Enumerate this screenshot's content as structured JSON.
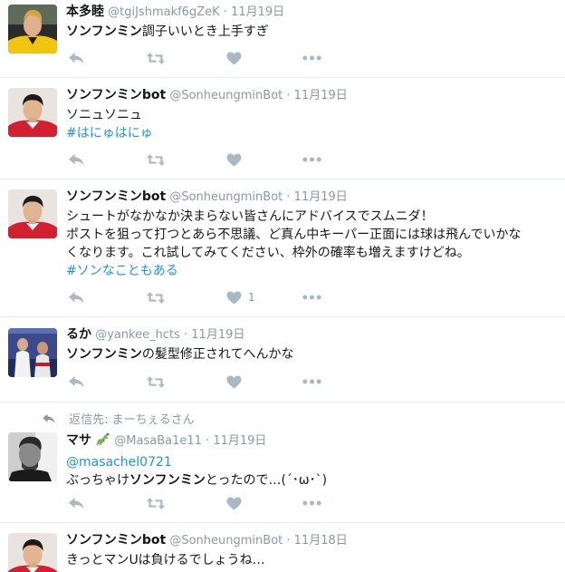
{
  "tweets": [
    {
      "name": "本多睦",
      "handle": "@tgiJshmakf6gZeK",
      "time": "11月19日",
      "body_hl": "ソンフンミン",
      "body_rest": "調子いいとき上手すぎ"
    },
    {
      "name": "ソンフンミンbot",
      "handle": "@SonheungminBot",
      "time": "11月19日",
      "line1": "ソニュソニュ",
      "hashtag": "#はにゅはにゅ"
    },
    {
      "name": "ソンフンミンbot",
      "handle": "@SonheungminBot",
      "time": "11月19日",
      "line1": "シュートがなかなか決まらない皆さんにアドバイスでスムニダ！",
      "line2": "ポストを狙って打つとあら不思議、ど真ん中キーパー正面には球は飛んでいかな",
      "line3": "くなります。これ試してみてください、枠外の確率も増えますけどね。",
      "hashtag": "#ソンなこともある",
      "like_count": "1"
    },
    {
      "name": "るか",
      "handle": "@yankee_hcts",
      "time": "11月19日",
      "body_hl": "ソンフンミン",
      "body_rest": "の髪型修正されてへんかな"
    },
    {
      "reply_context": "返信先: まーちぇるさん",
      "name": "マサ",
      "handle": "@MasaBa1e11",
      "time": "11月19日",
      "mention": "@masachel0721",
      "body_pre": "ぶっちゃけ",
      "body_hl": "ソンフンミン",
      "body_rest": "とったので…(´･ω･`)"
    },
    {
      "name": "ソンフンミンbot",
      "handle": "@SonheungminBot",
      "time": "11月18日",
      "line1": "きっとマンUは負けるでしょうね…"
    }
  ],
  "separator": "·",
  "colors": {
    "muted": "#8899a6",
    "link": "#1b95e0",
    "divider": "#e6ecf0",
    "icon": "#aab8c2"
  },
  "icons": [
    "reply-icon",
    "retweet-icon",
    "like-icon",
    "more-icon",
    "reply-context-icon",
    "lizard-emoji-icon"
  ]
}
